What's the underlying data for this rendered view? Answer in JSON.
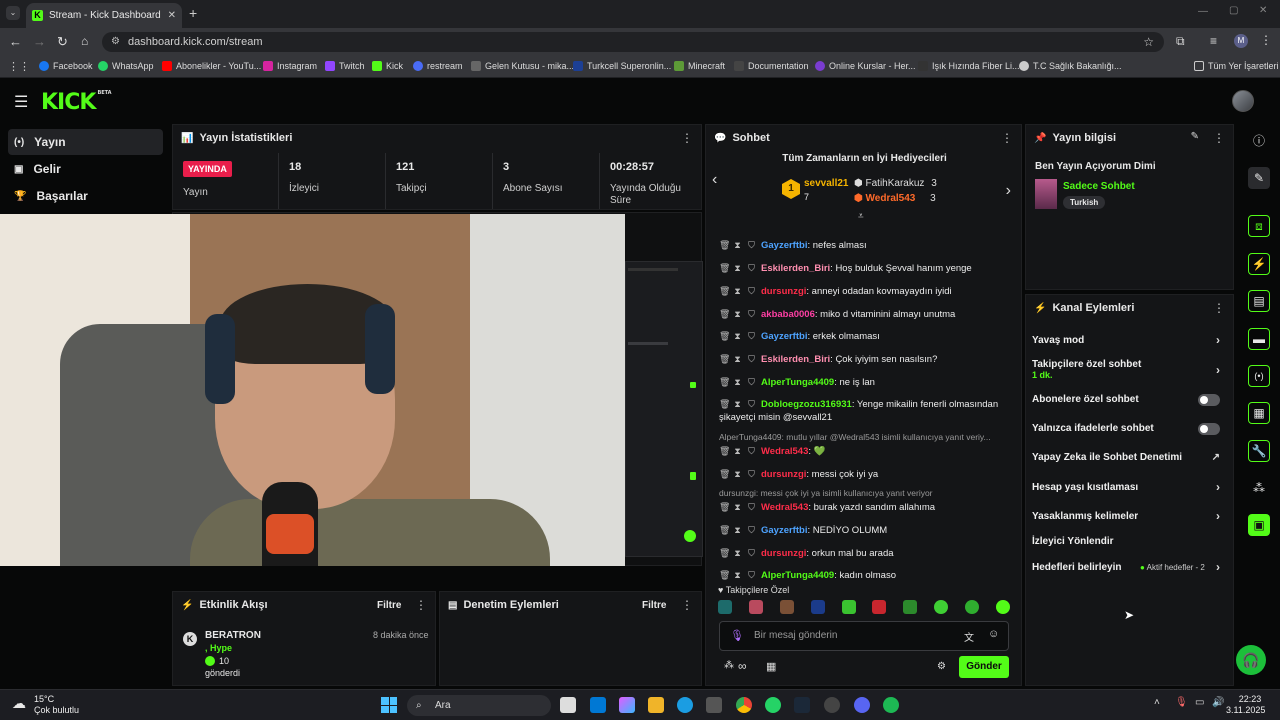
{
  "browser": {
    "tab_title": "Stream - Kick Dashboard",
    "url": "dashboard.kick.com/stream",
    "bookmarks": [
      "Facebook",
      "WhatsApp",
      "Abonelikler - YouTu...",
      "Instagram",
      "Twitch",
      "Kick",
      "restream",
      "Gelen Kutusu - mika...",
      "Turkcell Superonlin...",
      "Minecraft",
      "Documentation",
      "Online Kurslar - Her...",
      "Işık Hızında Fiber Li...",
      "T.C Sağlık Bakanlığı...",
      "Tüm Yer İşaretleri"
    ],
    "profile_initial": "M"
  },
  "brand": {
    "logo": "KICK",
    "beta": "BETA",
    "accent": "#53fc18"
  },
  "nav": {
    "items": [
      "Yayın",
      "Gelir",
      "Başarılar"
    ]
  },
  "stats": {
    "title": "Yayın İstatistikleri",
    "live_badge": "YAYINDA",
    "live_label": "Yayın",
    "items": [
      {
        "value": "18",
        "label": "İzleyici"
      },
      {
        "value": "121",
        "label": "Takipçi"
      },
      {
        "value": "3",
        "label": "Abone Sayısı"
      },
      {
        "value": "00:28:57",
        "label": "Yayında Olduğu Süre"
      }
    ]
  },
  "events": {
    "title": "Etkinlik Akışı",
    "filter": "Filtre",
    "user": "BERATRON",
    "time": "8 dakika önce",
    "type": ", Hype",
    "amount": "10",
    "action": "gönderdi"
  },
  "moderation": {
    "title": "Denetim Eylemleri",
    "filter": "Filtre"
  },
  "chat": {
    "title": "Sohbet",
    "top_title": "Tüm Zamanların en İyi Hediyecileri",
    "top1": {
      "rank": "1",
      "name": "sevvall21",
      "count": "7"
    },
    "top2": {
      "name": "FatihKarakuz",
      "count": "3"
    },
    "top3": {
      "name": "Wedral543",
      "count": "3"
    },
    "messages": [
      {
        "user": "Gayzerftbi",
        "color": "#4ea3ff",
        "text": ": nefes alması"
      },
      {
        "user": "Eskilerden_Biri",
        "color": "#ff8fb0",
        "text": ": Hoş bulduk Şevval hanım yenge"
      },
      {
        "user": "dursunzgi",
        "color": "#ff2d4a",
        "text": ": anneyi odadan kovmayaydın iyidi"
      },
      {
        "user": "akbaba0006",
        "color": "#ff3fa4",
        "text": ": miko d vitaminini almayı unutma"
      },
      {
        "user": "Gayzerftbi",
        "color": "#4ea3ff",
        "text": ": erkek olmaması"
      },
      {
        "user": "Eskilerden_Biri",
        "color": "#ff8fb0",
        "text": ": Çok iyiyim sen nasılsın?"
      },
      {
        "user": "AlperTunga4409",
        "color": "#53fc18",
        "text": ": ne iş lan"
      },
      {
        "user": "Dobloegzozu316931",
        "color": "#53fc18",
        "text": ": Yenge mikailin fenerli olmasından"
      },
      {
        "user": "",
        "color": "#ededed",
        "text": "şikayetçi misin @sevvall21"
      },
      {
        "user": "",
        "color": "#9a9a9a",
        "text": "AlperTunga4409: mutlu yıllar @Wedral543 isimli kullanıcıya yanıt veriy..."
      },
      {
        "user": "Wedral543",
        "color": "#ff2d4a",
        "text": ": 💚"
      },
      {
        "user": "dursunzgi",
        "color": "#ff2d4a",
        "text": ": messi çok iyi ya"
      },
      {
        "user": "",
        "color": "#9a9a9a",
        "text": "dursunzgi: messi çok iyi ya isimli kullanıcıya yanıt veriyor"
      },
      {
        "user": "Wedral543",
        "color": "#ff2d4a",
        "text": ": burak yazdı sandım allahıma"
      },
      {
        "user": "Gayzerftbi",
        "color": "#4ea3ff",
        "text": ": NEDİYO OLUMM"
      },
      {
        "user": "dursunzgi",
        "color": "#ff2d4a",
        "text": ": orkun mal bu arada"
      },
      {
        "user": "AlperTunga4409",
        "color": "#53fc18",
        "text": ": kadın olmaso"
      }
    ],
    "followers_only": "Takipçilere Özel",
    "input_placeholder": "Bir mesaj gönderin",
    "send": "Gönder",
    "infinity": "∞"
  },
  "stream_info": {
    "title": "Yayın bilgisi",
    "stream_title": "Ben Yayın Açıyorum Dimi",
    "category": "Sadece Sohbet",
    "tag": "Turkish"
  },
  "channel_actions": {
    "title": "Kanal Eylemleri",
    "slow_mode": "Yavaş mod",
    "followers_chat": "Takipçilere özel sohbet",
    "followers_duration": "1 dk.",
    "subscribers_chat": "Abonelere özel sohbet",
    "emote_only": "Yalnızca ifadelerle sohbet",
    "ai_moderation": "Yapay Zeka ile Sohbet Denetimi",
    "age_restriction": "Hesap yaşı kısıtlaması",
    "banned_words": "Yasaklanmış kelimeler",
    "redirect": "İzleyici Yönlendir",
    "goals": "Hedefleri belirleyin",
    "goals_status": "Aktif hedefler - 2"
  },
  "taskbar": {
    "temp": "15°C",
    "weather": "Çok bulutlu",
    "search": "Ara",
    "time": "22:23",
    "date": "3.11.2025"
  }
}
